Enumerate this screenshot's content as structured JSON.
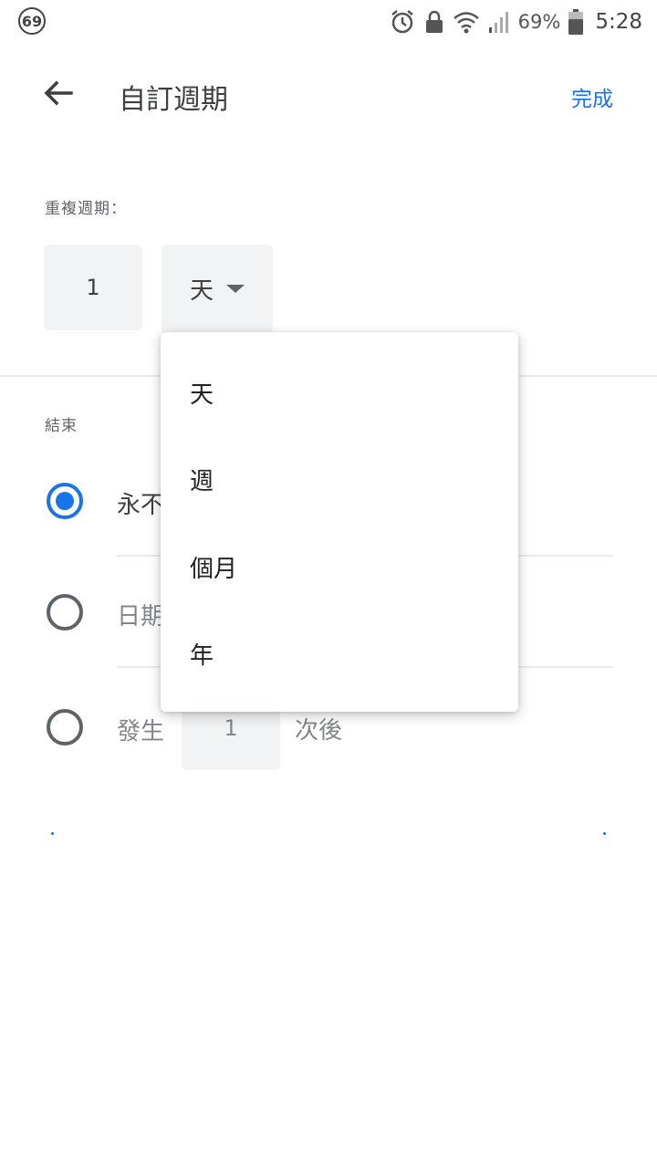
{
  "status_bar": {
    "notification_count": "69",
    "battery_percent": "69%",
    "time": "5:28",
    "icons": [
      "alarm-icon",
      "lock-icon",
      "wifi-icon",
      "signal-icon",
      "battery-icon"
    ]
  },
  "app_bar": {
    "back_icon": "arrow-back-icon",
    "title": "自訂週期",
    "done_label": "完成"
  },
  "repeat": {
    "label": "重複週期：",
    "interval_value": "1",
    "unit_selected": "天"
  },
  "end": {
    "label": "結束",
    "options": [
      {
        "label": "永不",
        "checked": true
      },
      {
        "label": "日期",
        "checked": false
      },
      {
        "label": "發生",
        "checked": false
      }
    ],
    "occurrences_value": "1",
    "occurrences_suffix": "次後"
  },
  "dropdown": {
    "items": [
      "天",
      "週",
      "個月",
      "年"
    ]
  },
  "colors": {
    "accent": "#1a73e8",
    "field_bg": "#f1f3f4",
    "text_primary": "#3c4043"
  }
}
